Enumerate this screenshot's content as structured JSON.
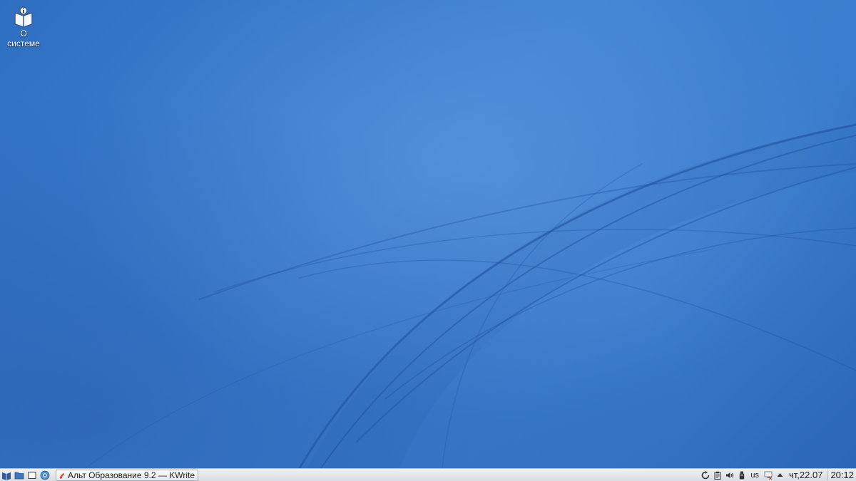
{
  "desktop": {
    "icons": [
      {
        "label": "О системе",
        "icon": "book-info-icon"
      }
    ]
  },
  "taskbar": {
    "launchers": [
      {
        "name": "menu-icon"
      },
      {
        "name": "file-manager-icon"
      },
      {
        "name": "show-desktop-icon"
      },
      {
        "name": "browser-icon"
      }
    ],
    "tasks": [
      {
        "title": "Альт Образование 9.2   — KWrite",
        "icon": "kwrite-icon"
      }
    ],
    "tray": {
      "keyboard_layout": "us",
      "date": "чт,22.07",
      "time": "20:12"
    }
  },
  "colors": {
    "desktop_blue": "#3a7ccd",
    "taskbar_bg": "#e4e8ed"
  }
}
